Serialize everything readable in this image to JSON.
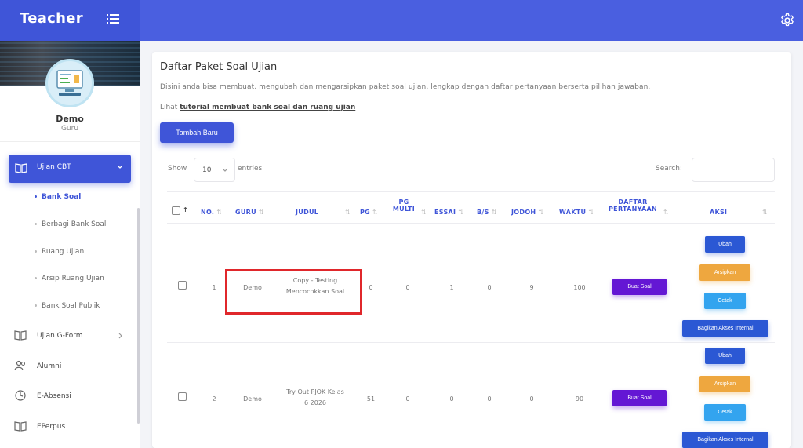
{
  "app": {
    "title": "Teacher"
  },
  "user": {
    "name": "Demo",
    "role": "Guru"
  },
  "sidebar": {
    "active": {
      "label": "Ujian CBT"
    },
    "subitems": [
      {
        "label": "Bank Soal"
      },
      {
        "label": "Berbagi Bank Soal"
      },
      {
        "label": "Ruang Ujian"
      },
      {
        "label": "Arsip Ruang Ujian"
      },
      {
        "label": "Bank Soal Publik"
      }
    ],
    "items": [
      {
        "label": "Ujian G-Form"
      },
      {
        "label": "Alumni"
      },
      {
        "label": "E-Absensi"
      },
      {
        "label": "EPerpus"
      }
    ]
  },
  "page": {
    "title": "Daftar Paket Soal Ujian",
    "description": "Disini anda bisa membuat, mengubah dan mengarsipkan paket soal ujian, lengkap dengan daftar pertanyaan berserta pilihan jawaban.",
    "tutorial_prefix": "Lihat",
    "tutorial_link": "tutorial membuat bank soal dan ruang ujian",
    "add_button": "Tambah Baru"
  },
  "table_controls": {
    "show_label": "Show",
    "entries_value": "10",
    "entries_label": "entries",
    "search_label": "Search:"
  },
  "table": {
    "headers": {
      "no": "NO.",
      "guru": "GURU",
      "judul": "JUDUL",
      "pg": "PG",
      "pg_multi_1": "PG",
      "pg_multi_2": "MULTI",
      "essai": "ESSAI",
      "bs": "B/S",
      "jodoh": "JODOH",
      "waktu": "WAKTU",
      "daftar_1": "DAFTAR",
      "daftar_2": "PERTANYAAN",
      "aksi": "AKSI"
    },
    "rows": [
      {
        "no": "1",
        "guru": "Demo",
        "judul_1": "Copy - Testing",
        "judul_2": "Mencocokkan Soal",
        "pg": "0",
        "pg_multi": "0",
        "essai": "1",
        "bs": "0",
        "jodoh": "9",
        "waktu": "100"
      },
      {
        "no": "2",
        "guru": "Demo",
        "judul_1": "Try Out PJOK Kelas",
        "judul_2": "6 2026",
        "pg": "51",
        "pg_multi": "0",
        "essai": "0",
        "bs": "0",
        "jodoh": "0",
        "waktu": "90"
      }
    ],
    "actions": {
      "buat_soal": "Buat Soal",
      "ubah": "Ubah",
      "arsipkan": "Arsipkan",
      "cetak": "Cetak",
      "bagikan": "Bagikan Akses Internal"
    }
  },
  "colors": {
    "primary": "#3f55d8",
    "topbar": "#4a5fe0",
    "archive": "#eea73f",
    "print": "#33a4ef",
    "create": "#6417d4",
    "highlight": "#e0272b"
  }
}
